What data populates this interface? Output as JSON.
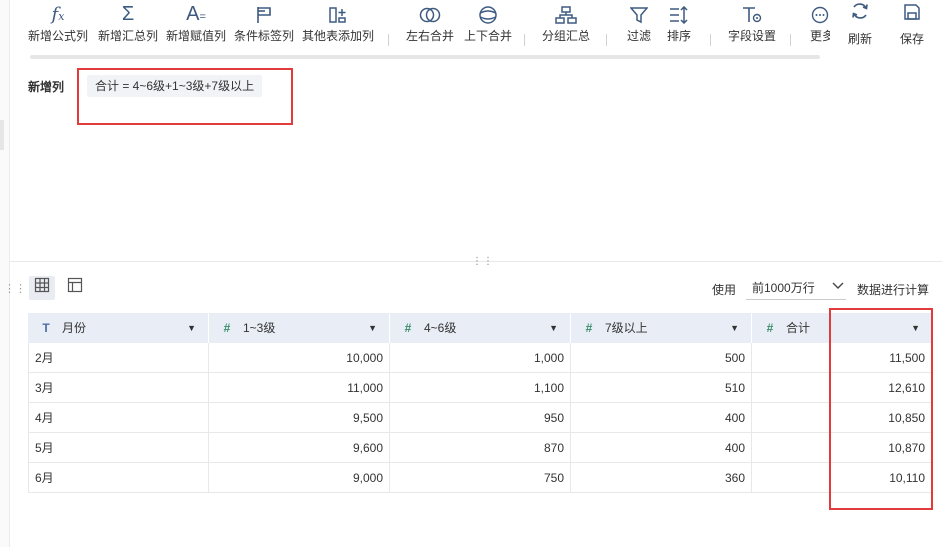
{
  "toolbar": {
    "items": [
      {
        "label": "新增公式列",
        "icon": "fx-icon"
      },
      {
        "label": "新增汇总列",
        "icon": "sigma-icon"
      },
      {
        "label": "新增赋值列",
        "icon": "assign-icon"
      },
      {
        "label": "条件标签列",
        "icon": "flag-icon"
      },
      {
        "label": "其他表添加列",
        "icon": "add-column-icon"
      },
      {
        "label": "左右合并",
        "icon": "merge-horizontal-icon"
      },
      {
        "label": "上下合并",
        "icon": "merge-vertical-icon"
      },
      {
        "label": "分组汇总",
        "icon": "group-icon"
      },
      {
        "label": "过滤",
        "icon": "filter-icon"
      },
      {
        "label": "排序",
        "icon": "sort-icon"
      },
      {
        "label": "字段设置",
        "icon": "field-settings-icon"
      },
      {
        "label": "更多",
        "icon": "more-icon"
      }
    ],
    "refresh_label": "刷新",
    "save_label": "保存"
  },
  "formula": {
    "label": "新增列",
    "expression": "合计 = 4~6级+1~3级+7级以上"
  },
  "controls": {
    "use_label": "使用",
    "limit_value": "前1000万行",
    "calc_label": "数据进行计算"
  },
  "table": {
    "columns": [
      {
        "name": "月份",
        "type": "text"
      },
      {
        "name": "1~3级",
        "type": "number"
      },
      {
        "name": "4~6级",
        "type": "number"
      },
      {
        "name": "7级以上",
        "type": "number"
      },
      {
        "name": "合计",
        "type": "number"
      }
    ],
    "rows": [
      [
        "2月",
        "10,000",
        "1,000",
        "500",
        "11,500"
      ],
      [
        "3月",
        "11,000",
        "1,100",
        "510",
        "12,610"
      ],
      [
        "4月",
        "9,500",
        "950",
        "400",
        "10,850"
      ],
      [
        "5月",
        "9,600",
        "870",
        "400",
        "10,870"
      ],
      [
        "6月",
        "9,000",
        "750",
        "360",
        "10,110"
      ]
    ]
  },
  "colors": {
    "highlight": "#e23b3b",
    "header_bg": "#e9eef6",
    "icon": "#3d5a80",
    "number_type": "#3c8c6a"
  }
}
